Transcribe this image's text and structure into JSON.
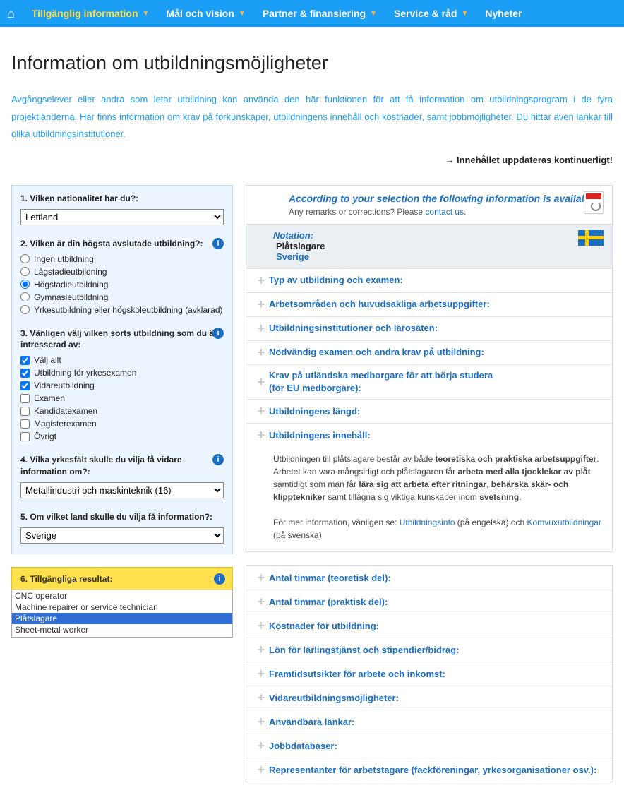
{
  "nav": {
    "items": [
      {
        "label": "Tillgänglig information",
        "active": true,
        "caret": true
      },
      {
        "label": "Mål och vision",
        "active": false,
        "caret": true
      },
      {
        "label": "Partner & finansiering",
        "active": false,
        "caret": true
      },
      {
        "label": "Service & råd",
        "active": false,
        "caret": true
      },
      {
        "label": "Nyheter",
        "active": false,
        "caret": false
      }
    ]
  },
  "page": {
    "title": "Information om utbildningsmöjligheter",
    "intro": "Avgångselever eller andra som letar utbildning kan använda den här funktionen för att få information om utbildningsprogram i de fyra projektländerna. Här finns information om krav på förkunskaper, utbildningens innehåll och kostnader, samt jobbmöjligheter. Du hittar även länkar till olika utbildningsinstitutioner.",
    "update_note": "→ Innehållet uppdateras kontinuerligt!"
  },
  "filters": {
    "q1": {
      "label": "1. Vilken nationalitet har du?:",
      "value": "Lettland"
    },
    "q2": {
      "label": "2. Vilken är din högsta avslutade utbildning?:",
      "options": [
        "Ingen utbildning",
        "Lågstadieutbildning",
        "Högstadieutbildning",
        "Gymnasieutbildning",
        "Yrkesutbildning eller högskoleutbildning (avklarad)"
      ],
      "selected": "Högstadieutbildning"
    },
    "q3": {
      "label": "3. Vänligen välj vilken sorts utbildning som du är intresserad av:",
      "options": [
        {
          "label": "Välj allt",
          "checked": true
        },
        {
          "label": "Utbildning för yrkesexamen",
          "checked": true
        },
        {
          "label": "Vidareutbildning",
          "checked": true
        },
        {
          "label": "Examen",
          "checked": false
        },
        {
          "label": "Kandidatexamen",
          "checked": false
        },
        {
          "label": "Magisterexamen",
          "checked": false
        },
        {
          "label": "Övrigt",
          "checked": false
        }
      ]
    },
    "q4": {
      "label": "4. Vilka yrkesfält skulle du vilja få vidare information om?:",
      "value": "Metallindustri och maskinteknik (16)"
    },
    "q5": {
      "label": "5. Om vilket land skulle du vilja få information?:",
      "value": "Sverige"
    },
    "q6": {
      "label": "6. Tillgängliga resultat:",
      "options": [
        "CNC operator",
        "Machine repairer or service technician",
        "Plåtslagare",
        "Sheet-metal worker"
      ],
      "selected": "Plåtslagare"
    }
  },
  "main": {
    "heading": "According to your selection the following information is available",
    "remarks_prefix": "Any remarks or corrections? Please ",
    "remarks_link": "contact us",
    "remarks_suffix": ".",
    "notation_label": "Notation:",
    "notation_name": "Plåtslagare",
    "notation_country": "Sverige",
    "sections_a": [
      "Typ av utbildning och examen:",
      "Arbetsområden och huvudsakliga arbetsuppgifter:",
      "Utbildningsinstitutioner och lärosäten:",
      "Nödvändig examen och andra krav på utbildning:",
      "Krav på utländska medborgare för att börja studera\n(för EU medborgare):",
      "Utbildningens längd:"
    ],
    "expanded": {
      "title": "Utbildningens innehåll:",
      "body_html": "Utbildningen till plåtslagare består av både <b>teoretiska och praktiska arbetsuppgifter</b>. Arbetet kan vara mångsidigt och  plåtslagaren får <b>arbeta med alla tjocklekar av plåt</b> samtidigt som man får <b>lära sig att arbeta efter ritningar</b>, <b>behärska skär- och klipptekniker</b> samt tillägna sig viktiga kunskaper inom <b>svetsning</b>.<br><br>För mer information, vänligen se: <a href='#'>Utbildningsinfo</a> (på engelska) och <a href='#'>Komvuxutbildningar</a> (på svenska)"
    },
    "sections_b": [
      "Antal timmar (teoretisk del):",
      "Antal timmar (praktisk del):",
      "Kostnader för utbildning:",
      "Lön för lärlingstjänst och stipendier/bidrag:",
      "Framtidsutsikter för arbete och inkomst:",
      "Vidareutbildningsmöjligheter:",
      "Användbara länkar:",
      "Jobbdatabaser:",
      "Representanter för arbetstagare (fackföreningar, yrkesorganisationer osv.):"
    ]
  }
}
